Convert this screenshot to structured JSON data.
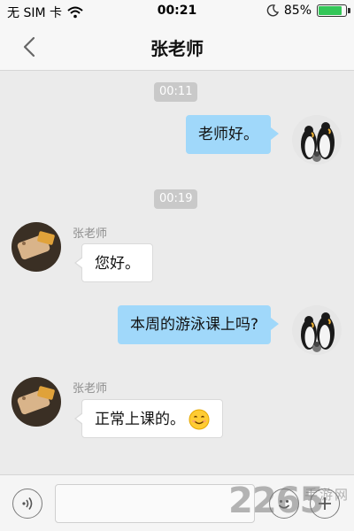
{
  "status_bar": {
    "carrier": "无 SIM 卡",
    "time": "00:21",
    "battery_text": "85%",
    "battery_level": 0.85,
    "icons": [
      "wifi-icon",
      "moon-icon",
      "battery-icon"
    ]
  },
  "nav": {
    "title": "张老师",
    "back_icon": "chevron-left-icon"
  },
  "chat": {
    "timestamps": [
      "00:11",
      "00:19"
    ],
    "sender_name": "张老师",
    "messages": [
      {
        "side": "right",
        "text": "老师好。"
      },
      {
        "side": "left",
        "sender": "张老师",
        "text": "您好。"
      },
      {
        "side": "right",
        "text": "本周的游泳课上吗?"
      },
      {
        "side": "left",
        "sender": "张老师",
        "text": "正常上课的。",
        "emoji": "smiling-face"
      }
    ]
  },
  "input_bar": {
    "message_value": "",
    "icons": [
      "voice-icon",
      "emoji-icon",
      "plus-icon"
    ]
  },
  "watermark": {
    "number": "2265",
    "text": "手游网"
  },
  "colors": {
    "background": "#ebebeb",
    "bubble_self": "#a0d8fa",
    "bubble_other": "#ffffff",
    "battery": "#35c759"
  }
}
